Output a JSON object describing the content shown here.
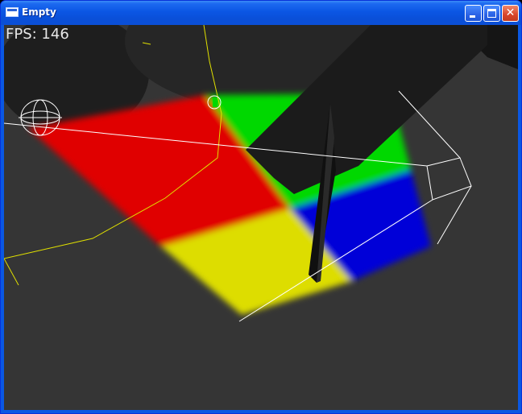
{
  "window": {
    "title": "Empty"
  },
  "overlay": {
    "fps_text": "FPS: 146"
  },
  "icons": {
    "app": "window-icon",
    "minimize": "minimize-icon",
    "maximize": "maximize-icon",
    "close": "close-icon"
  },
  "colors": {
    "titlebar": "#0b56e4",
    "background": "#333333",
    "red": "#e00000",
    "green": "#00d800",
    "blue": "#0000d8",
    "yellow": "#dddd00",
    "wire": "#ffffff",
    "path": "#e0e000"
  }
}
